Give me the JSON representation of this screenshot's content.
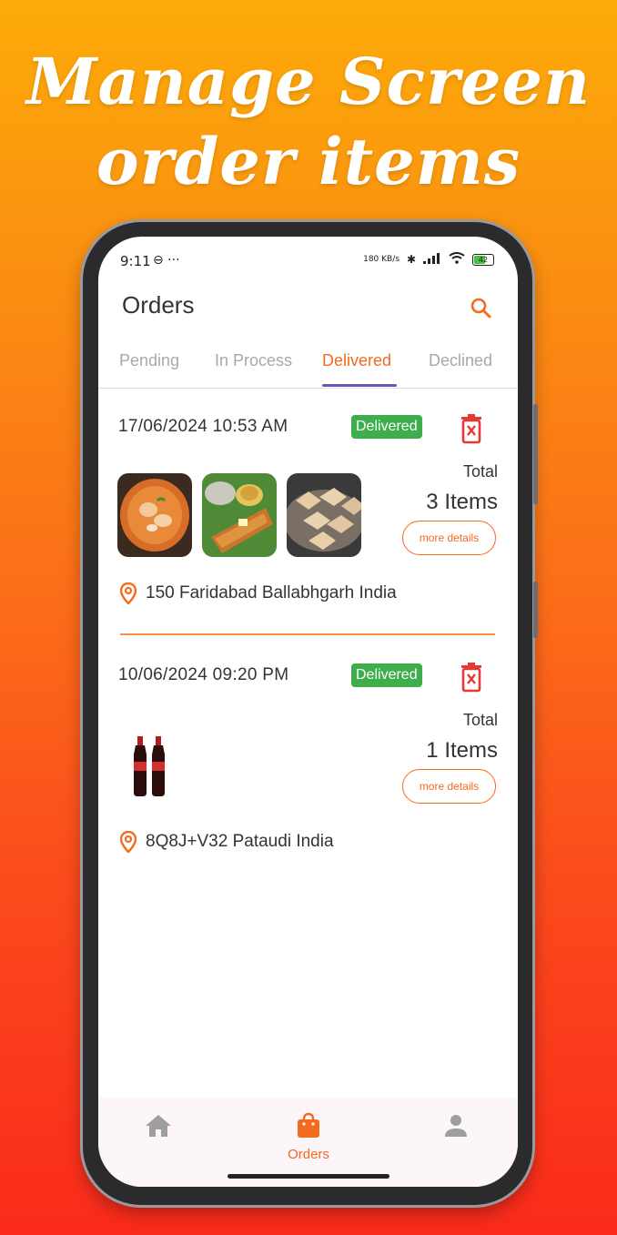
{
  "promo": {
    "line1": "Manage Screen",
    "line2": "order items"
  },
  "status_bar": {
    "time": "9:11",
    "dots": "⊖ ···",
    "speed": "180 KB/s",
    "battery": "42"
  },
  "appbar": {
    "title": "Orders",
    "search_icon": "search-icon"
  },
  "tabs": [
    {
      "label": "Pending"
    },
    {
      "label": "In Process"
    },
    {
      "label": "Delivered"
    },
    {
      "label": "Declined"
    }
  ],
  "active_tab": "Delivered",
  "orders": [
    {
      "date": "17/06/2024 10:53 AM",
      "status": "Delivered",
      "total_label": "Total",
      "items_count": "3 Items",
      "more_label": "more details",
      "address": "150 Faridabad Ballabhgarh India",
      "thumbnails": [
        "paneer-curry",
        "masala-dosa",
        "kaju-katli"
      ]
    },
    {
      "date": "10/06/2024 09:20 PM",
      "status": "Delivered",
      "total_label": "Total",
      "items_count": "1 Items",
      "more_label": "more details",
      "address": "8Q8J+V32 Pataudi  India",
      "thumbnails": [
        "cola-bottles"
      ]
    }
  ],
  "bottom_nav": [
    {
      "label": "",
      "icon": "home-icon"
    },
    {
      "label": "Orders",
      "icon": "shopping-bag-icon"
    },
    {
      "label": "",
      "icon": "person-icon"
    }
  ],
  "colors": {
    "accent": "#f46a1f",
    "delivered": "#3dae4b",
    "delete": "#e53935",
    "tab_indicator": "#6b54b6"
  }
}
